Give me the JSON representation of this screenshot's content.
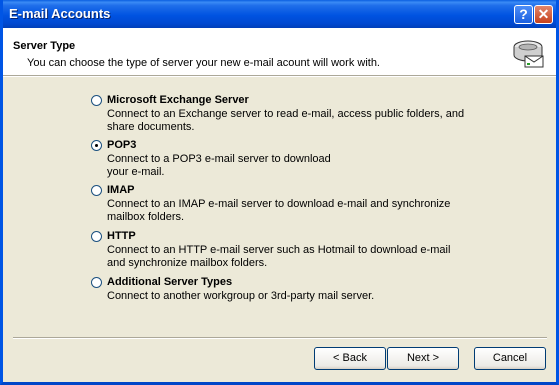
{
  "window": {
    "title": "E-mail Accounts",
    "help_label": "?",
    "close_label": "✕"
  },
  "header": {
    "title": "Server Type",
    "subtitle": "You can choose the type of server your new e-mail acount will work with.",
    "icon": "mail-server-icon"
  },
  "options": [
    {
      "label": "Microsoft Exchange Server",
      "description": "Connect to an Exchange server to read e-mail, access public folders, and share documents.",
      "selected": false
    },
    {
      "label": "POP3",
      "description": "Connect to a POP3 e-mail server to download your e-mail.",
      "selected": true
    },
    {
      "label": "IMAP",
      "description": "Connect to an IMAP e-mail server to download e-mail and synchronize mailbox folders.",
      "selected": false
    },
    {
      "label": "HTTP",
      "description": "Connect to an HTTP e-mail server such as Hotmail to download e-mail and synchronize mailbox folders.",
      "selected": false
    },
    {
      "label": "Additional Server Types",
      "description": "Connect to another workgroup or 3rd-party mail server.",
      "selected": false
    }
  ],
  "buttons": {
    "back": "< Back",
    "next": "Next >",
    "cancel": "Cancel"
  },
  "colors": {
    "titlebar": "#0053e1",
    "dialog_bg": "#ece9d8"
  }
}
